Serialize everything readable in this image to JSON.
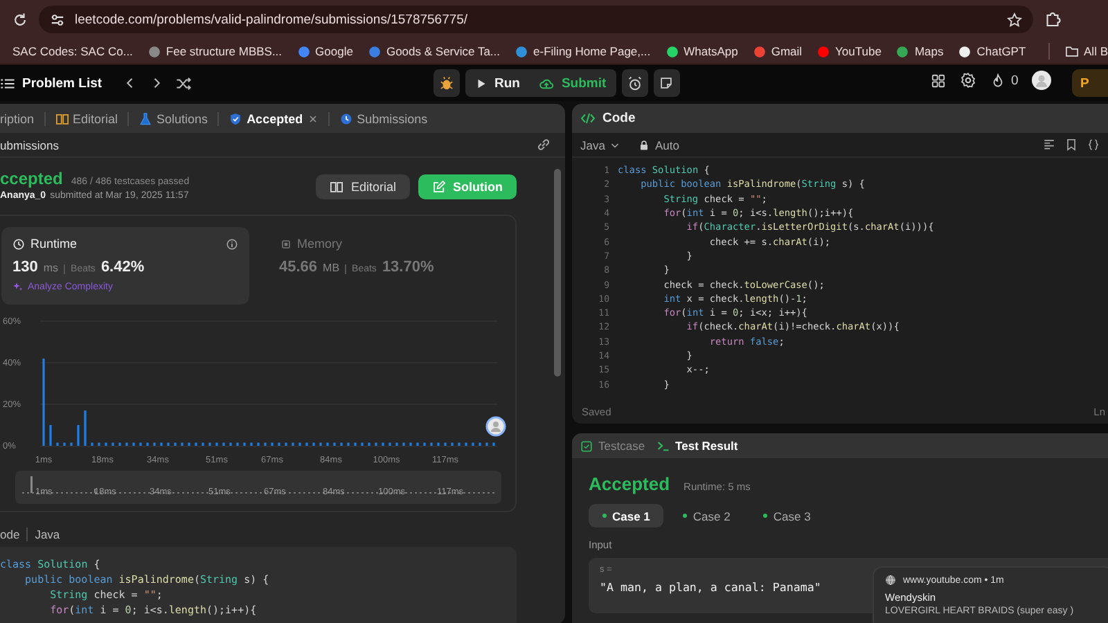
{
  "browser": {
    "url": "leetcode.com/problems/valid-palindrome/submissions/1578756775/",
    "bookmarks": [
      "SAC Codes: SAC Co...",
      "Fee structure MBBS...",
      "Google",
      "Goods & Service Ta...",
      "e-Filing Home Page,...",
      "WhatsApp",
      "Gmail",
      "YouTube",
      "Maps",
      "ChatGPT"
    ],
    "all_bookmarks": "All B"
  },
  "topbar": {
    "problem_list": "Problem List",
    "run": "Run",
    "submit": "Submit",
    "streak": "0",
    "premium": "P"
  },
  "left_panel": {
    "tabs": [
      {
        "label": "ription",
        "selected": false,
        "closable": false
      },
      {
        "label": "Editorial",
        "selected": false,
        "closable": false
      },
      {
        "label": "Solutions",
        "selected": false,
        "closable": false
      },
      {
        "label": "Accepted",
        "selected": true,
        "closable": true
      },
      {
        "label": "Submissions",
        "selected": false,
        "closable": false
      }
    ],
    "breadcrumb": "ubmissions",
    "status": "ccepted",
    "testcases": "486 / 486 testcases passed",
    "user": "Ananya_0",
    "submitted": "submitted at Mar 19, 2025 11:57",
    "buttons": [
      {
        "label": "Editorial",
        "kind": "secondary"
      },
      {
        "label": "Solution",
        "kind": "primary"
      }
    ],
    "metrics": [
      {
        "title": "Runtime",
        "value": "130",
        "unit": "ms",
        "beats_label": "Beats",
        "beats": "6.42%",
        "selected": true,
        "link": "Analyze Complexity"
      },
      {
        "title": "Memory",
        "value": "45.66",
        "unit": "MB",
        "beats_label": "Beats",
        "beats": "13.70%",
        "selected": false
      }
    ],
    "chart_data": {
      "type": "bar",
      "xlim": [
        0,
        132
      ],
      "ylim": [
        0,
        60
      ],
      "x": [
        1,
        3,
        5,
        7,
        9,
        11,
        13,
        15,
        17,
        19,
        21,
        23,
        25,
        27,
        29,
        31,
        33,
        35,
        37,
        39,
        41,
        43,
        45,
        47,
        49,
        51,
        53,
        55,
        57,
        59,
        61,
        63,
        65,
        67,
        69,
        71,
        73,
        75,
        77,
        79,
        81,
        83,
        85,
        87,
        89,
        91,
        93,
        95,
        97,
        99,
        101,
        103,
        105,
        107,
        109,
        111,
        113,
        115,
        117,
        119,
        121,
        123,
        125,
        127,
        129,
        131
      ],
      "series": [
        {
          "color": "#1e7ee6",
          "values": [
            42,
            10,
            1.5,
            1.5,
            1.5,
            10,
            17,
            1.5,
            1.5,
            1.5,
            1.5,
            1.5,
            1.5,
            1.5,
            1.5,
            1.5,
            1.5,
            1.5,
            1.5,
            1.5,
            1.5,
            1.5,
            1.5,
            1.5,
            1.5,
            1.5,
            1.5,
            1.5,
            1.5,
            1.5,
            1.5,
            1.5,
            1.5,
            1.5,
            1.5,
            1.5,
            1.5,
            1.5,
            1.5,
            1.5,
            1.5,
            1.5,
            1.5,
            1.5,
            1.5,
            1.5,
            1.5,
            1.5,
            1.5,
            1.5,
            1.5,
            1.5,
            1.5,
            1.5,
            1.5,
            1.5,
            1.5,
            1.5,
            1.5,
            1.5,
            1.5,
            1.5,
            1.5,
            1.5,
            1.5,
            1.5
          ]
        }
      ],
      "xticks": [
        {
          "value": 1,
          "label": "1ms"
        },
        {
          "value": 18,
          "label": "18ms"
        },
        {
          "value": 34,
          "label": "34ms"
        },
        {
          "value": 51,
          "label": "51ms"
        },
        {
          "value": 67,
          "label": "67ms"
        },
        {
          "value": 84,
          "label": "84ms"
        },
        {
          "value": 100,
          "label": "100ms"
        },
        {
          "value": 117,
          "label": "117ms"
        }
      ],
      "yticks": [
        {
          "value": 0,
          "label": "0%"
        },
        {
          "value": 20,
          "label": "20%"
        },
        {
          "value": 40,
          "label": "40%"
        },
        {
          "value": 60,
          "label": "60%"
        }
      ]
    },
    "brush_labels": [
      "1ms",
      "18ms",
      "34ms",
      "51ms",
      "67ms",
      "84ms",
      "100ms",
      "117ms"
    ],
    "code_title": "ode",
    "code_language": "Java",
    "code_lines": [
      {
        "tokens": [
          {
            "kind": "keyword",
            "text": "class"
          },
          {
            "kind": "type",
            "text": " Solution"
          },
          {
            "kind": "plain",
            "text": " {"
          }
        ],
        "children": [
          {
            "tokens": [
              {
                "kind": "keyword",
                "text": "public boolean"
              },
              {
                "kind": "function",
                "text": " isPalindrome"
              },
              {
                "kind": "plain",
                "text": "("
              },
              {
                "kind": "type",
                "text": "String"
              },
              {
                "kind": "plain",
                "text": " s) {"
              }
            ],
            "children": [
              {
                "tokens": [
                  {
                    "kind": "type",
                    "text": "String"
                  },
                  {
                    "kind": "plain",
                    "text": " check = "
                  },
                  {
                    "kind": "string",
                    "text": "\"\""
                  },
                  {
                    "kind": "plain",
                    "text": ";"
                  }
                ]
              },
              {
                "tokens": [
                  {
                    "kind": "control",
                    "text": "for"
                  },
                  {
                    "kind": "plain",
                    "text": "("
                  },
                  {
                    "kind": "keyword",
                    "text": "int"
                  },
                  {
                    "kind": "plain",
                    "text": " i = "
                  },
                  {
                    "kind": "number",
                    "text": "0"
                  },
                  {
                    "kind": "plain",
                    "text": "; i<s."
                  },
                  {
                    "kind": "function",
                    "text": "length"
                  },
                  {
                    "kind": "plain",
                    "text": "();i++){"
                  }
                ]
              }
            ]
          }
        ]
      }
    ]
  },
  "code_panel": {
    "title": "Code",
    "language": "Java",
    "mode": "Auto",
    "status": "Saved",
    "cursor": "Ln",
    "lines": [
      {
        "number": "1",
        "tokens": [
          {
            "kind": "keyword",
            "text": "class"
          },
          {
            "kind": "type",
            "text": " Solution"
          },
          {
            "kind": "plain",
            "text": " {"
          }
        ],
        "children": [
          {
            "number": "2",
            "tokens": [
              {
                "kind": "keyword",
                "text": "public boolean"
              },
              {
                "kind": "function",
                "text": " isPalindrome"
              },
              {
                "kind": "plain",
                "text": "("
              },
              {
                "kind": "type",
                "text": "String"
              },
              {
                "kind": "plain",
                "text": " s) {"
              }
            ],
            "children": [
              {
                "number": "3",
                "tokens": [
                  {
                    "kind": "type",
                    "text": "String"
                  },
                  {
                    "kind": "plain",
                    "text": " check = "
                  },
                  {
                    "kind": "string",
                    "text": "\"\""
                  },
                  {
                    "kind": "plain",
                    "text": ";"
                  }
                ]
              },
              {
                "number": "4",
                "tokens": [
                  {
                    "kind": "control",
                    "text": "for"
                  },
                  {
                    "kind": "plain",
                    "text": "("
                  },
                  {
                    "kind": "keyword",
                    "text": "int"
                  },
                  {
                    "kind": "plain",
                    "text": " i = "
                  },
                  {
                    "kind": "number",
                    "text": "0"
                  },
                  {
                    "kind": "plain",
                    "text": "; i<s."
                  },
                  {
                    "kind": "function",
                    "text": "length"
                  },
                  {
                    "kind": "plain",
                    "text": "();i++){"
                  }
                ],
                "children": [
                  {
                    "number": "5",
                    "tokens": [
                      {
                        "kind": "control",
                        "text": "if"
                      },
                      {
                        "kind": "plain",
                        "text": "("
                      },
                      {
                        "kind": "type",
                        "text": "Character"
                      },
                      {
                        "kind": "plain",
                        "text": "."
                      },
                      {
                        "kind": "function",
                        "text": "isLetterOrDigit"
                      },
                      {
                        "kind": "plain",
                        "text": "(s."
                      },
                      {
                        "kind": "function",
                        "text": "charAt"
                      },
                      {
                        "kind": "plain",
                        "text": "(i))){"
                      }
                    ],
                    "children": [
                      {
                        "number": "6",
                        "tokens": [
                          {
                            "kind": "plain",
                            "text": "check += s."
                          },
                          {
                            "kind": "function",
                            "text": "charAt"
                          },
                          {
                            "kind": "plain",
                            "text": "(i);"
                          }
                        ]
                      }
                    ]
                  },
                  {
                    "number": "7",
                    "tokens": [
                      {
                        "kind": "plain",
                        "text": "}"
                      }
                    ]
                  }
                ]
              },
              {
                "number": "8",
                "tokens": [
                  {
                    "kind": "plain",
                    "text": "}"
                  }
                ]
              },
              {
                "number": "9",
                "tokens": [
                  {
                    "kind": "plain",
                    "text": "check = check."
                  },
                  {
                    "kind": "function",
                    "text": "toLowerCase"
                  },
                  {
                    "kind": "plain",
                    "text": "();"
                  }
                ]
              },
              {
                "number": "10",
                "tokens": [
                  {
                    "kind": "keyword",
                    "text": "int"
                  },
                  {
                    "kind": "plain",
                    "text": " x = check."
                  },
                  {
                    "kind": "function",
                    "text": "length"
                  },
                  {
                    "kind": "plain",
                    "text": "()-"
                  },
                  {
                    "kind": "number",
                    "text": "1"
                  },
                  {
                    "kind": "plain",
                    "text": ";"
                  }
                ]
              },
              {
                "number": "11",
                "tokens": [
                  {
                    "kind": "control",
                    "text": "for"
                  },
                  {
                    "kind": "plain",
                    "text": "("
                  },
                  {
                    "kind": "keyword",
                    "text": "int"
                  },
                  {
                    "kind": "plain",
                    "text": " i = "
                  },
                  {
                    "kind": "number",
                    "text": "0"
                  },
                  {
                    "kind": "plain",
                    "text": "; i<x; i++){"
                  }
                ],
                "children": [
                  {
                    "number": "12",
                    "tokens": [
                      {
                        "kind": "control",
                        "text": "if"
                      },
                      {
                        "kind": "plain",
                        "text": "(check."
                      },
                      {
                        "kind": "function",
                        "text": "charAt"
                      },
                      {
                        "kind": "plain",
                        "text": "(i)!=check."
                      },
                      {
                        "kind": "function",
                        "text": "charAt"
                      },
                      {
                        "kind": "plain",
                        "text": "(x)){"
                      }
                    ],
                    "children": [
                      {
                        "number": "13",
                        "tokens": [
                          {
                            "kind": "control",
                            "text": "return"
                          },
                          {
                            "kind": "keyword",
                            "text": " false"
                          },
                          {
                            "kind": "plain",
                            "text": ";"
                          }
                        ]
                      }
                    ]
                  },
                  {
                    "number": "14",
                    "tokens": [
                      {
                        "kind": "plain",
                        "text": "}"
                      }
                    ]
                  },
                  {
                    "number": "15",
                    "tokens": [
                      {
                        "kind": "plain",
                        "text": "x--;"
                      }
                    ]
                  }
                ]
              },
              {
                "number": "16",
                "tokens": [
                  {
                    "kind": "plain",
                    "text": "}"
                  }
                ]
              }
            ]
          }
        ]
      }
    ]
  },
  "result_panel": {
    "tabs": [
      {
        "label": "Testcase",
        "selected": false
      },
      {
        "label": "Test Result",
        "selected": true
      }
    ],
    "verdict": "Accepted",
    "runtime": "Runtime: 5 ms",
    "cases": [
      {
        "label": "Case 1",
        "selected": true
      },
      {
        "label": "Case 2",
        "selected": false
      },
      {
        "label": "Case 3",
        "selected": false
      }
    ],
    "input_label": "Input",
    "param": "s =",
    "value": "\"A man, a plan, a canal: Panama\""
  },
  "notification": {
    "source": "www.youtube.com • 1m",
    "title": "Wendyskin",
    "body": "LOVERGIRL HEART BRAIDS (super easy )"
  }
}
